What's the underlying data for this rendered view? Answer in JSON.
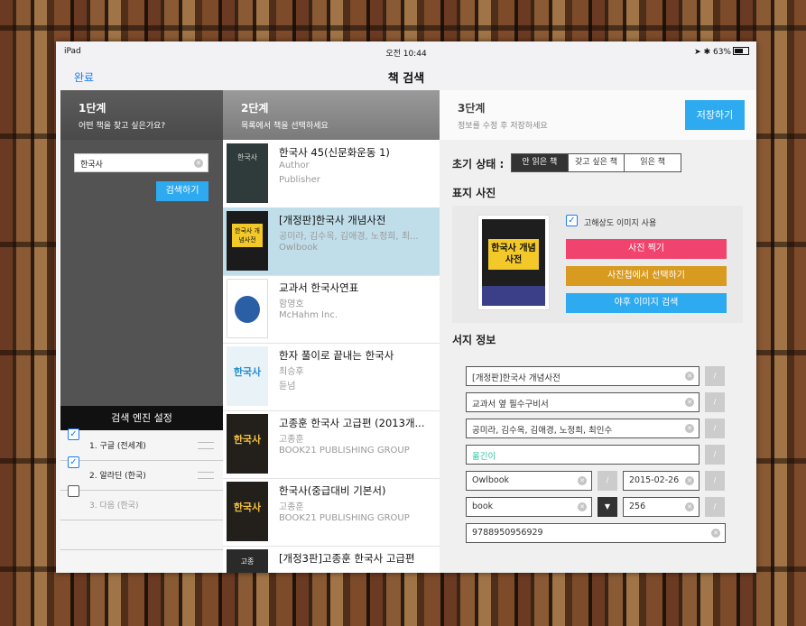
{
  "status": {
    "device": "iPad",
    "time": "오전 10:44",
    "battery": "63%"
  },
  "nav": {
    "done": "완료",
    "title": "책 검색"
  },
  "step1": {
    "title": "1단계",
    "subtitle": "어떤 책을 찾고 싶은가요?",
    "search_value": "한국사",
    "search_button": "검색하기",
    "engine_header": "검색 엔진 설정",
    "engines": [
      {
        "label": "1. 구글 (전세계)",
        "checked": true
      },
      {
        "label": "2. 알라딘 (한국)",
        "checked": true
      },
      {
        "label": "3. 다음 (한국)",
        "checked": false
      }
    ]
  },
  "step2": {
    "title": "2단계",
    "subtitle": "목록에서 책을 선택하세요",
    "books": [
      {
        "title": "한국사 45(신문화운동 1)",
        "author": "Author",
        "publisher": "Publisher",
        "cover": "#2f3b3a"
      },
      {
        "title": "[개정판]한국사 개념사전",
        "author": "공미라, 김수옥, 김애경, 노정희, 최...",
        "publisher": "Owlbook",
        "cover": "#1b1b1b"
      },
      {
        "title": "교과서 한국사연표",
        "author": "함영호",
        "publisher": "McHahm Inc.",
        "cover": "#2a5fa6"
      },
      {
        "title": "한자 풀이로 끝내는 한국사",
        "author": "최승후",
        "publisher": "듣넘",
        "cover": "#e9f2f7"
      },
      {
        "title": "고종훈 한국사 고급편 (2013개...",
        "author": "고종훈",
        "publisher": "BOOK21 PUBLISHING GROUP",
        "cover": "#23201c"
      },
      {
        "title": "한국사(중급대비 기본서)",
        "author": "고종훈",
        "publisher": "BOOK21 PUBLISHING GROUP",
        "cover": "#23201c"
      },
      {
        "title": "[개정3판]고종훈 한국사 고급편",
        "author": "",
        "publisher": "",
        "cover": "#2a2a2a"
      }
    ],
    "cover_texts": {
      "b1": "한국사",
      "b2": "한국사 개념사전",
      "b4": "한국사",
      "b5": "한국사",
      "b6": "한국사",
      "b7": "고종"
    }
  },
  "step3": {
    "title": "3단계",
    "subtitle": "정보를 수정 후 저장하세요",
    "save": "저장하기",
    "state_label": "초기 상태 :",
    "states": [
      "안 읽은 책",
      "갖고 싶은 책",
      "읽은 책"
    ],
    "cover_label": "표지 사진",
    "hq_label": "고해상도 이미지 사용",
    "photo_buttons": [
      "사진 찍기",
      "사진첩에서 선택하기",
      "야후 이미지 검색"
    ],
    "cover_title": "한국사 개념사전",
    "info_label": "서지 정보",
    "fields": {
      "title": "[개정판]한국사 개념사전",
      "subtitle": "교과서 옆 필수구비서",
      "authors": "공미라, 김수옥, 김애경, 노정희, 최인수",
      "translator": "옮긴이",
      "publisher": "Owlbook",
      "date": "2015-02-26",
      "type": "book",
      "pages": "256",
      "isbn": "9788950956929"
    },
    "colors": {
      "pink": "#f0446e",
      "orange": "#d89a1f",
      "blue": "#2eaaf0"
    }
  }
}
